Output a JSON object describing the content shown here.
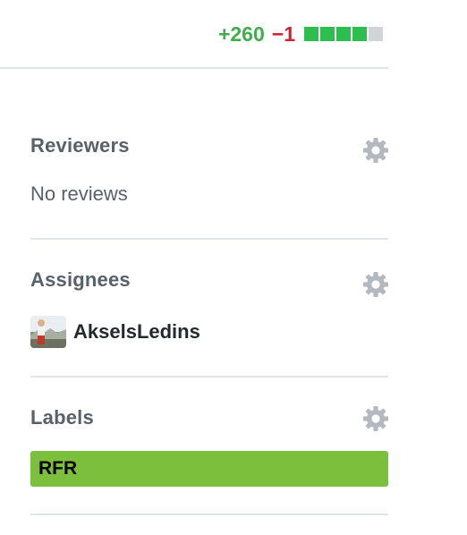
{
  "diffstat": {
    "additions": "+260",
    "deletions": "−1",
    "blocks": [
      "green",
      "green",
      "green",
      "green",
      "gray"
    ]
  },
  "sidebar": {
    "reviewers": {
      "heading": "Reviewers",
      "empty_text": "No reviews",
      "icon": "gear-icon"
    },
    "assignees": {
      "heading": "Assignees",
      "icon": "gear-icon",
      "users": [
        {
          "login": "AkselsLedins",
          "avatar": "avatar"
        }
      ]
    },
    "labels": {
      "heading": "Labels",
      "icon": "gear-icon",
      "items": [
        {
          "name": "RFR",
          "color": "#7cbf3c"
        }
      ]
    }
  },
  "colors": {
    "additions": "#3fae4b",
    "deletions": "#cb2431",
    "heading": "#586069",
    "divider": "#e1e4e8",
    "gear": "#b3b9bf"
  }
}
